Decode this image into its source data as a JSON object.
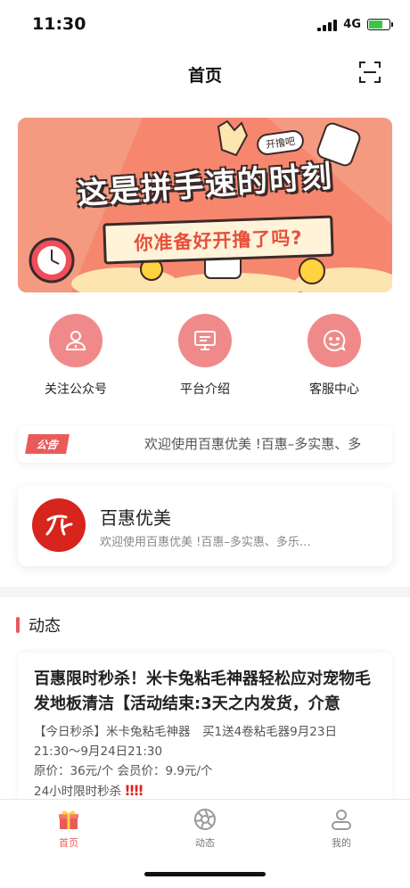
{
  "status_bar": {
    "time": "11:30",
    "network": "4G"
  },
  "nav": {
    "title": "首页",
    "scan_icon": "scan-icon"
  },
  "banner": {
    "title": "这是拼手速的时刻",
    "subtitle": "你准备好开撸了吗?",
    "tag": "开撸吧",
    "colors": {
      "bg": "#f6876e",
      "text": "#ffffff",
      "accent": "#e8503c"
    }
  },
  "quick_links": [
    {
      "label": "关注公众号",
      "icon": "user-icon"
    },
    {
      "label": "平台介绍",
      "icon": "monitor-icon"
    },
    {
      "label": "客服中心",
      "icon": "smile-icon"
    }
  ],
  "notice": {
    "tag": "公告",
    "text": "欢迎使用百惠优美 !百惠–多实惠、多"
  },
  "brand": {
    "name": "百惠优美",
    "description": "欢迎使用百惠优美 !百惠–多实惠、多乐…"
  },
  "feed": {
    "heading": "动态",
    "post": {
      "title": "百惠限时秒杀！米卡兔粘毛神器轻松应对宠物毛发地板清洁【活动结束:3天之内发货，介意",
      "line1": "【今日秒杀】米卡兔粘毛神器　买1送4卷粘毛器9月23日",
      "line2": "21:30～9月24日21:30",
      "line3": "原价：36元/个 会员价：9.9元/个",
      "line4": "24小时限时秒杀",
      "emphasis": "‼‼"
    }
  },
  "tabs": [
    {
      "label": "首页",
      "icon": "gift-icon",
      "active": true
    },
    {
      "label": "动态",
      "icon": "aperture-icon",
      "active": false
    },
    {
      "label": "我的",
      "icon": "profile-icon",
      "active": false
    }
  ],
  "colors": {
    "accent": "#e95a5a",
    "brand_red": "#d7241c",
    "circle": "#f08a8a"
  }
}
